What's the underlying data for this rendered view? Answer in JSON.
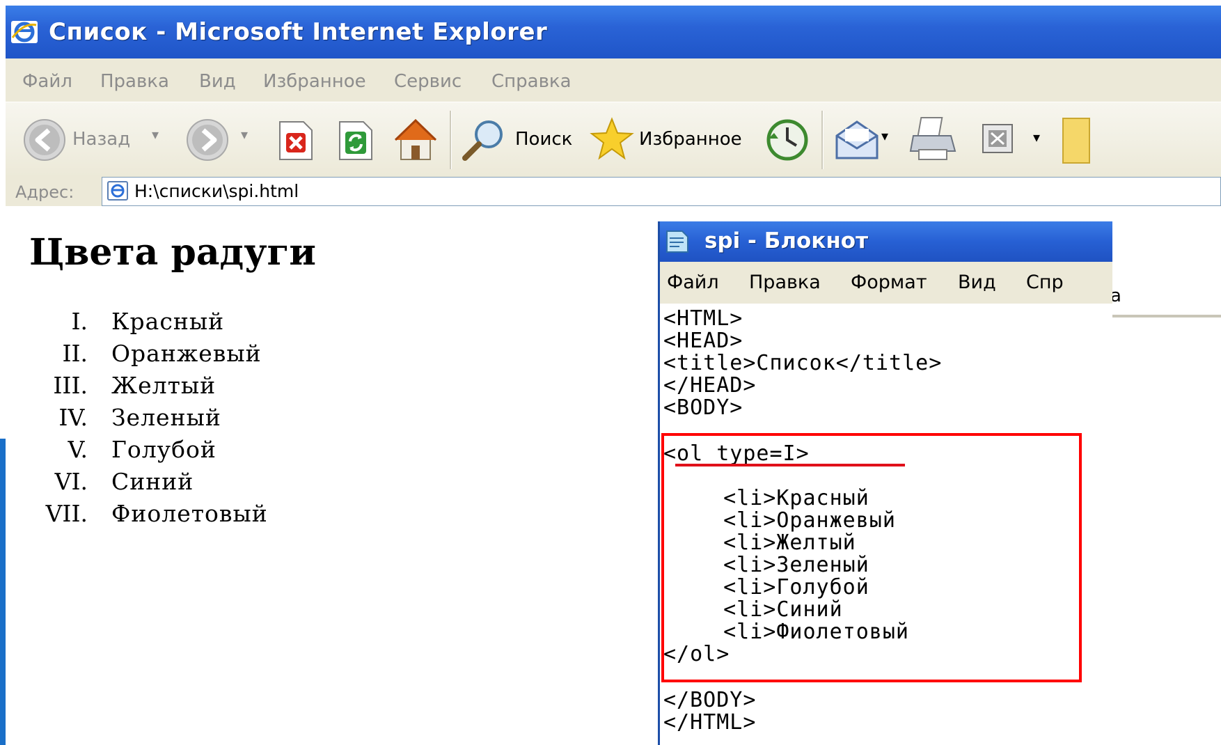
{
  "browser": {
    "title": "Список - Microsoft Internet Explorer",
    "menu": [
      "Файл",
      "Правка",
      "Вид",
      "Избранное",
      "Сервис",
      "Справка"
    ],
    "toolbar": {
      "back_label": "Назад",
      "search_label": "Поиск",
      "favorites_label": "Избранное"
    },
    "address": {
      "label": "Адрес:",
      "url": "H:\\списки\\spi.html"
    }
  },
  "page": {
    "heading": "Цвета радуги",
    "list": [
      {
        "num": "I.",
        "text": "Красный"
      },
      {
        "num": "II.",
        "text": "Оранжевый"
      },
      {
        "num": "III.",
        "text": "Желтый"
      },
      {
        "num": "IV.",
        "text": "Зеленый"
      },
      {
        "num": "V.",
        "text": "Голубой"
      },
      {
        "num": "VI.",
        "text": "Синий"
      },
      {
        "num": "VII.",
        "text": "Фиолетовый"
      }
    ]
  },
  "notepad": {
    "title": "spi - Блокнот",
    "menu": [
      "Файл",
      "Правка",
      "Формат",
      "Вид",
      "Спр"
    ],
    "stray_char": "а",
    "code": [
      "<HTML>",
      "<HEAD>",
      "<title>Список</title>",
      "</HEAD>",
      "<BODY>",
      "<ol type=I>",
      "  <li>Красный",
      "  <li>Оранжевый",
      "  <li>Желтый",
      "  <li>Зеленый",
      "  <li>Голубой",
      "  <li>Синий",
      "  <li>Фиолетовый",
      "</ol>",
      "</BODY>",
      "</HTML>"
    ]
  },
  "colors": {
    "xp_title_blue": "#2a63d6",
    "highlight_red": "#ff0000",
    "slide_accent": "#1a6fc8"
  },
  "icons": [
    "ie-logo-icon",
    "back-arrow-icon",
    "forward-arrow-icon",
    "stop-icon",
    "refresh-icon",
    "home-icon",
    "search-icon",
    "favorites-star-icon",
    "history-icon",
    "mail-icon",
    "print-icon",
    "edit-icon",
    "folder-icon",
    "page-icon",
    "notepad-icon"
  ]
}
